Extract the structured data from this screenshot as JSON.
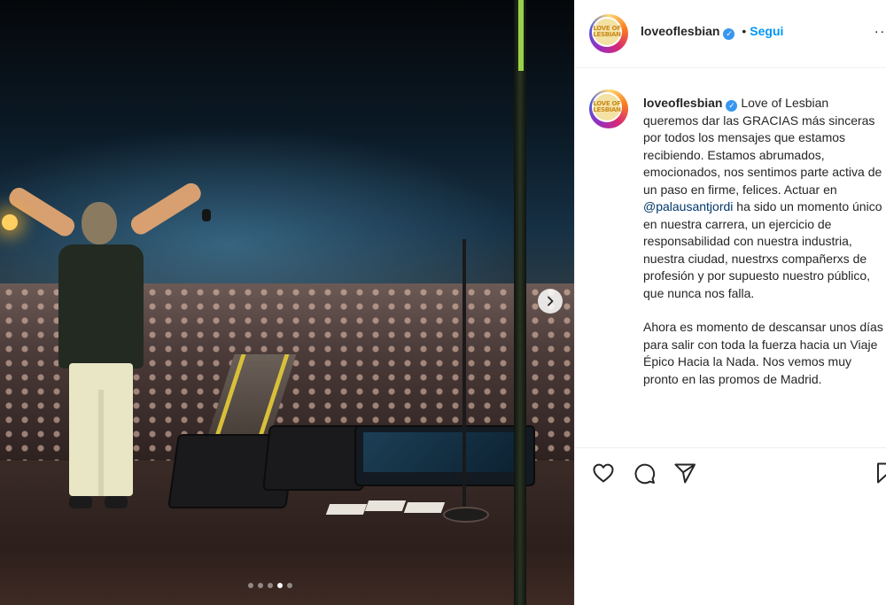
{
  "photo": {
    "alt": "",
    "carousel": {
      "total": 5,
      "active_index": 3
    }
  },
  "post": {
    "username": "loveoflesbian",
    "verified": true,
    "follow_label": "Segui",
    "separator": "•",
    "more_label": "...",
    "avatar_text": "LOVE OF LESBIAN"
  },
  "caption": {
    "username": "loveoflesbian",
    "part1": " Love of Lesbian queremos dar las GRACIAS más sinceras por todos los mensajes que estamos recibiendo. Estamos abrumados, emocionados, nos sentimos parte activa de un paso en firme, felices. Actuar en ",
    "mention": "@palausantjordi",
    "part2": " ha sido un momento único en nuestra carrera, un ejercicio de responsabilidad con nuestra industria, nuestra ciudad, nuestrxs compañerxs de profesión y por supuesto nuestro público, que nunca nos falla.",
    "paragraph2": "Ahora es momento de descansar unos días para salir con toda la fuerza hacia un Viaje Épico Hacia la Nada. Nos vemos muy pronto en las promos de Madrid."
  },
  "actions": {
    "like_icon": "heart-icon",
    "comment_icon": "comment-icon",
    "share_icon": "share-icon",
    "save_icon": "bookmark-icon"
  },
  "colors": {
    "link": "#0095f6",
    "mention": "#00376b",
    "text": "#262626",
    "border": "#efefef"
  }
}
